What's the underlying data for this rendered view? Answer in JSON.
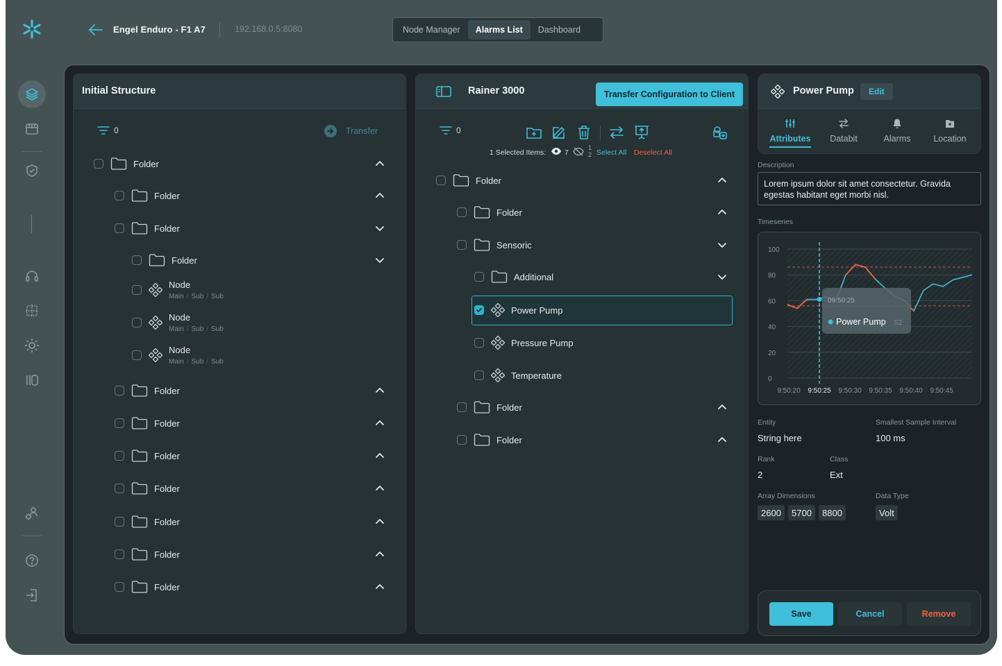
{
  "topbar": {
    "title": "Engel Enduro - F1 A7",
    "ip": "192.168.0.5:8080",
    "tabs": [
      {
        "label": "Node Manager"
      },
      {
        "label": "Alarms List"
      },
      {
        "label": "Dashboard"
      }
    ],
    "active_tab": "Alarms List"
  },
  "left_panel": {
    "title": "Initial Structure",
    "filter_count": "0",
    "transfer_label": "Transfer",
    "items": [
      {
        "label": "Folder",
        "level": 0,
        "chevron": "up"
      },
      {
        "label": "Folder",
        "level": 1,
        "chevron": "up"
      },
      {
        "label": "Folder",
        "level": 1,
        "chevron": "down"
      },
      {
        "label": "Folder",
        "level": 2,
        "chevron": "down"
      },
      {
        "label": "Node",
        "level": 2,
        "sub": [
          "Main",
          "Sub",
          "Sub"
        ]
      },
      {
        "label": "Node",
        "level": 2,
        "sub": [
          "Main",
          "Sub",
          "Sub"
        ]
      },
      {
        "label": "Node",
        "level": 2,
        "sub": [
          "Main",
          "Sub",
          "Sub"
        ]
      },
      {
        "label": "Folder",
        "level": 1,
        "chevron": "up"
      },
      {
        "label": "Folder",
        "level": 1,
        "chevron": "up"
      },
      {
        "label": "Folder",
        "level": 1,
        "chevron": "up"
      },
      {
        "label": "Folder",
        "level": 1,
        "chevron": "up"
      },
      {
        "label": "Folder",
        "level": 1,
        "chevron": "up"
      },
      {
        "label": "Folder",
        "level": 1,
        "chevron": "up"
      },
      {
        "label": "Folder",
        "level": 1,
        "chevron": "up"
      }
    ]
  },
  "middle_panel": {
    "title": "Rainer 3000",
    "transfer_button": "Transfer Configuration to Client",
    "filter_count": "0",
    "selected_items_label": "1 Selected Items:",
    "visible_count": "7",
    "hidden_count_top": "1",
    "hidden_count_bottom": "2",
    "select_all": "Select All",
    "deselect_all": "Deselect All",
    "items": [
      {
        "label": "Folder",
        "level": 0,
        "type": "folder",
        "chevron": "up"
      },
      {
        "label": "Folder",
        "level": 1,
        "type": "folder",
        "chevron": "up"
      },
      {
        "label": "Sensoric",
        "level": 1,
        "type": "folder",
        "chevron": "down"
      },
      {
        "label": "Additional",
        "level": 2,
        "type": "folder",
        "chevron": "down"
      },
      {
        "label": "Power Pump",
        "level": 2,
        "type": "node",
        "checked": true
      },
      {
        "label": "Pressure Pump",
        "level": 2,
        "type": "node"
      },
      {
        "label": "Temperature",
        "level": 2,
        "type": "node"
      },
      {
        "label": "Folder",
        "level": 1,
        "type": "folder",
        "chevron": "up"
      },
      {
        "label": "Folder",
        "level": 1,
        "type": "folder",
        "chevron": "up"
      }
    ]
  },
  "right_panel": {
    "title": "Power Pump",
    "edit_label": "Edit",
    "tabs": [
      {
        "label": "Attributes",
        "icon": "sliders-icon"
      },
      {
        "label": "Databit",
        "icon": "swap-icon"
      },
      {
        "label": "Alarms",
        "icon": "bell-icon"
      },
      {
        "label": "Location",
        "icon": "location-icon"
      }
    ],
    "description_label": "Description",
    "description": "Lorem ipsum dolor sit amet consectetur. Gravida egestas habitant eget morbi nisl.",
    "timeseries_label": "Timeseries",
    "entity_label": "Entity",
    "entity_value": "String here",
    "interval_label": "Smallest Sample Interval",
    "interval_value": "100 ms",
    "rank_label": "Rank",
    "rank_value": "2",
    "class_label": "Class",
    "class_value": "Ext",
    "array_label": "Array Dimensions",
    "array_values": [
      "2600",
      "5700",
      "8800"
    ],
    "datatype_label": "Data Type",
    "datatype_value": "Volt",
    "save": "Save",
    "cancel": "Cancel",
    "remove": "Remove"
  },
  "colors": {
    "accent": "#3fbfd9",
    "danger": "#f0613f",
    "frame": "#1b2326",
    "panel": "#273235"
  },
  "chart_data": {
    "type": "line",
    "x": [
      "9:50:20",
      "9:50:25",
      "9:50:30",
      "9:50:35",
      "9:50:40",
      "9:50:45"
    ],
    "ylim": [
      0,
      100
    ],
    "yticks": [
      0,
      20,
      40,
      60,
      80,
      100
    ],
    "threshold_lines": [
      86,
      56
    ],
    "cursor_x": "9:50:25",
    "series": [
      {
        "name": "Power Pump",
        "color": "#3fbfd9",
        "points": [
          [
            0,
            57
          ],
          [
            1,
            54
          ],
          [
            2,
            61
          ],
          [
            3,
            61
          ],
          [
            4,
            63
          ],
          [
            5,
            60
          ],
          [
            6,
            80
          ],
          [
            7,
            88
          ],
          [
            8,
            86
          ],
          [
            9,
            77
          ],
          [
            10,
            70
          ],
          [
            11,
            64
          ],
          [
            12,
            60
          ],
          [
            13,
            52
          ],
          [
            14,
            68
          ],
          [
            15,
            73
          ],
          [
            16,
            71
          ],
          [
            17,
            76
          ],
          [
            18,
            78
          ],
          [
            19,
            80
          ]
        ]
      }
    ],
    "highlight_segments": [
      [
        0,
        2
      ],
      [
        6,
        9
      ],
      [
        12,
        13
      ]
    ],
    "tooltip": {
      "time": "09:50:25",
      "series": "Power Pump",
      "suffix": "S2"
    }
  }
}
